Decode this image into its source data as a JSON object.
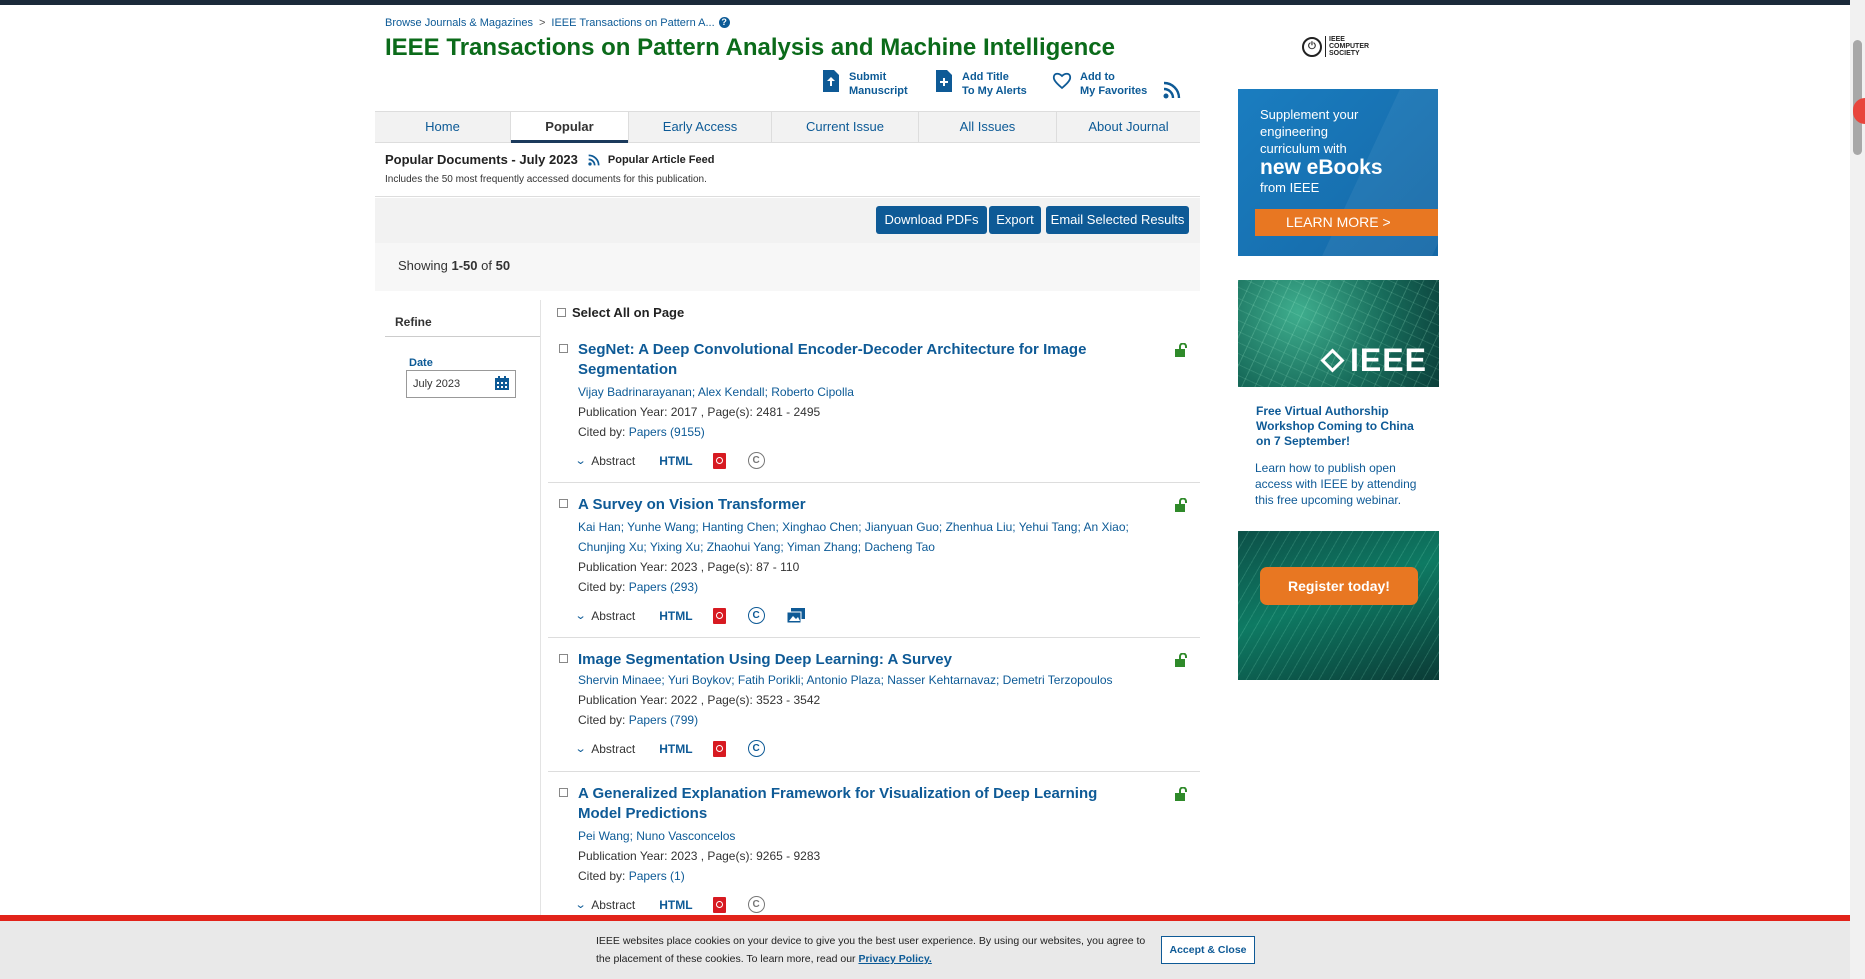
{
  "breadcrumb": {
    "item1": "Browse Journals & Magazines",
    "sep": ">",
    "item2": "IEEE Transactions on Pattern A...",
    "help": "?"
  },
  "page_title": "IEEE Transactions on Pattern Analysis and Machine Intelligence",
  "header_actions": {
    "submit": [
      "Submit",
      "Manuscript"
    ],
    "alerts": [
      "Add Title",
      "To My Alerts"
    ],
    "favorites": [
      "Add to",
      "My Favorites"
    ]
  },
  "nav_tabs": [
    "Home",
    "Popular",
    "Early Access",
    "Current Issue",
    "All Issues",
    "About Journal"
  ],
  "active_tab": "Popular",
  "popular": {
    "heading": "Popular Documents - July 2023",
    "feed_label": "Popular Article Feed",
    "subtext": "Includes the 50 most frequently accessed documents for this publication."
  },
  "toolbar": {
    "download": "Download PDFs",
    "export": "Export",
    "email": "Email Selected Results"
  },
  "showing": {
    "prefix": "Showing ",
    "range": "1-50",
    "of": " of ",
    "total": "50"
  },
  "refine": {
    "title": "Refine",
    "date_label": "Date",
    "date_value": "July 2023"
  },
  "select_all": "Select All on Page",
  "results": [
    {
      "title": "SegNet: A Deep Convolutional Encoder-Decoder Architecture for Image Segmentation",
      "authors": "Vijay Badrinarayanan; Alex Kendall; Roberto Cipolla",
      "meta": "Publication Year: 2017 , Page(s): 2481  -  2495",
      "cited_label": "Cited by: ",
      "cited_link": "Papers (9155)",
      "abstract": "Abstract",
      "html": "HTML"
    },
    {
      "title": "A Survey on Vision Transformer",
      "authors": "Kai Han; Yunhe Wang; Hanting Chen; Xinghao Chen; Jianyuan Guo; Zhenhua Liu; Yehui Tang; An Xiao; Chunjing Xu; Yixing Xu; Zhaohui Yang; Yiman Zhang; Dacheng Tao",
      "meta": "Publication Year: 2023 , Page(s): 87  -  110",
      "cited_label": "Cited by: ",
      "cited_link": "Papers (293)",
      "abstract": "Abstract",
      "html": "HTML"
    },
    {
      "title": "Image Segmentation Using Deep Learning: A Survey",
      "authors": "Shervin Minaee; Yuri Boykov; Fatih Porikli; Antonio Plaza; Nasser Kehtarnavaz; Demetri Terzopoulos",
      "meta": "Publication Year: 2022 , Page(s): 3523  -  3542",
      "cited_label": "Cited by: ",
      "cited_link": "Papers (799)",
      "abstract": "Abstract",
      "html": "HTML"
    },
    {
      "title": "A Generalized Explanation Framework for Visualization of Deep Learning Model Predictions",
      "authors": "Pei Wang; Nuno Vasconcelos",
      "meta": "Publication Year: 2023 , Page(s): 9265  -  9283",
      "cited_label": "Cited by: ",
      "cited_link": "Papers (1)",
      "abstract": "Abstract",
      "html": "HTML"
    }
  ],
  "sidebar": {
    "society_logo": [
      "IEEE",
      "COMPUTER",
      "SOCIETY"
    ],
    "ad1": {
      "lines": [
        "Supplement your",
        "engineering",
        "curriculum with"
      ],
      "big": "new eBooks",
      "small": "from IEEE",
      "cta": "LEARN MORE >"
    },
    "ad2": {
      "logo": "IEEE",
      "title": "Free Virtual  Authorship Workshop Coming to China on 7 September!",
      "body": "Learn how to publish open access with IEEE by attending this free upcoming webinar."
    },
    "ad3": {
      "cta": "Register today!"
    }
  },
  "cookie": {
    "text": "IEEE websites place cookies on your device to give you the best user experience. By using our websites, you agree to the placement of these cookies. To learn more, read our ",
    "link": "Privacy Policy.",
    "accept": "Accept & Close"
  },
  "colors": {
    "title_green": "#0b6b1a",
    "link_blue": "#0c5a96",
    "button_blue": "#0e5a96",
    "orange": "#e87722",
    "cookie_red": "#e2231a"
  }
}
